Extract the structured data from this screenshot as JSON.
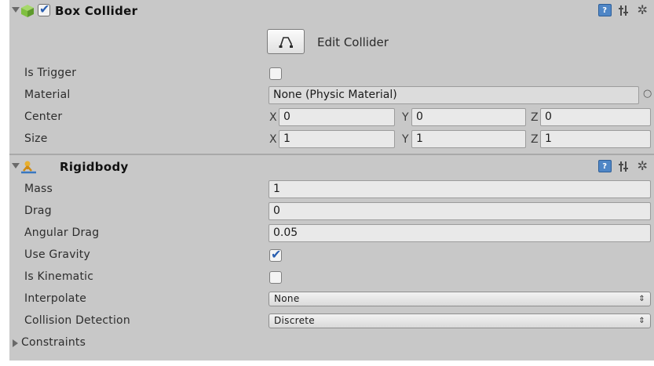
{
  "box_collider": {
    "title": "Box Collider",
    "enabled": true,
    "edit_collider_label": "Edit Collider",
    "is_trigger": {
      "label": "Is Trigger",
      "checked": false
    },
    "material": {
      "label": "Material",
      "value": "None (Physic Material)"
    },
    "center": {
      "label": "Center",
      "x_axis": "X",
      "y_axis": "Y",
      "z_axis": "Z",
      "x": "0",
      "y": "0",
      "z": "0"
    },
    "size": {
      "label": "Size",
      "x_axis": "X",
      "y_axis": "Y",
      "z_axis": "Z",
      "x": "1",
      "y": "1",
      "z": "1"
    }
  },
  "rigidbody": {
    "title": "Rigidbody",
    "mass": {
      "label": "Mass",
      "value": "1"
    },
    "drag": {
      "label": "Drag",
      "value": "0"
    },
    "angular_drag": {
      "label": "Angular Drag",
      "value": "0.05"
    },
    "use_gravity": {
      "label": "Use Gravity",
      "checked": true
    },
    "is_kinematic": {
      "label": "Is Kinematic",
      "checked": false
    },
    "interpolate": {
      "label": "Interpolate",
      "value": "None"
    },
    "collision_detection": {
      "label": "Collision Detection",
      "value": "Discrete"
    },
    "constraints": {
      "label": "Constraints",
      "expanded": false
    }
  },
  "glyphs": {
    "help": "?",
    "checkmark": "✔",
    "object_picker": "○",
    "dropdown_arrow": "⇕",
    "gear": "✲"
  },
  "colors": {
    "panel": "#c8c8c8",
    "field": "#e9e9e9",
    "accent": "#2a5fb0",
    "collider_icon": "#7fbf3f",
    "rigidbody_icon": "#e0a020"
  },
  "icons": [
    "fold-arrow-icon",
    "box-collider-icon",
    "enable-checkbox",
    "help-icon",
    "preset-icon",
    "gear-icon",
    "edit-collider-icon",
    "rigidbody-icon",
    "object-picker-icon",
    "dropdown-arrow-icon",
    "foldout-arrow-icon"
  ]
}
